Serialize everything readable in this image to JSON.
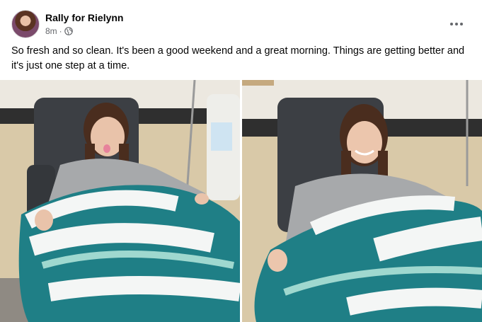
{
  "post": {
    "author": "Rally for Rielynn",
    "timestamp": "8m",
    "separator": "·",
    "audience_icon": "globe-icon",
    "more_icon": "more-options-icon",
    "text": "So fresh and so clean. It's been a good weekend and a great morning. Things are getting better and it's just one step at a time."
  },
  "photos": [
    {
      "description_icon": "photo-girl-tongue-out"
    },
    {
      "description_icon": "photo-girl-smiling"
    }
  ],
  "colors": {
    "meta_gray": "#65676b",
    "teal": "#1f7f86",
    "mint": "#9fd8cf",
    "white_yarn": "#f4f6f5",
    "hoodie": "#a7a9ab",
    "chair": "#3c3f44",
    "wall": "#e6dfd2"
  }
}
